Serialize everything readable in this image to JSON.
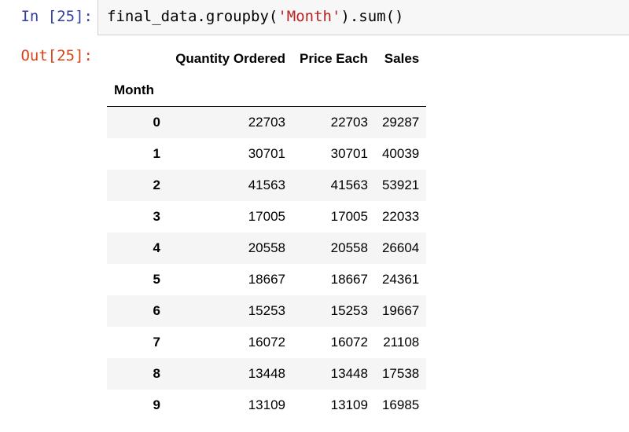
{
  "input_prompt": "In [25]:",
  "output_prompt": "Out[25]:",
  "code": {
    "prefix": "final_data.groupby(",
    "string_arg": "'Month'",
    "suffix": ").sum()"
  },
  "table": {
    "index_name": "Month",
    "columns": [
      "Quantity Ordered",
      "Price Each",
      "Sales"
    ],
    "rows": [
      {
        "index": "0",
        "values": [
          "22703",
          "22703",
          "29287"
        ]
      },
      {
        "index": "1",
        "values": [
          "30701",
          "30701",
          "40039"
        ]
      },
      {
        "index": "2",
        "values": [
          "41563",
          "41563",
          "53921"
        ]
      },
      {
        "index": "3",
        "values": [
          "17005",
          "17005",
          "22033"
        ]
      },
      {
        "index": "4",
        "values": [
          "20558",
          "20558",
          "26604"
        ]
      },
      {
        "index": "5",
        "values": [
          "18667",
          "18667",
          "24361"
        ]
      },
      {
        "index": "6",
        "values": [
          "15253",
          "15253",
          "19667"
        ]
      },
      {
        "index": "7",
        "values": [
          "16072",
          "16072",
          "21108"
        ]
      },
      {
        "index": "8",
        "values": [
          "13448",
          "13448",
          "17538"
        ]
      },
      {
        "index": "9",
        "values": [
          "13109",
          "13109",
          "16985"
        ]
      }
    ]
  }
}
